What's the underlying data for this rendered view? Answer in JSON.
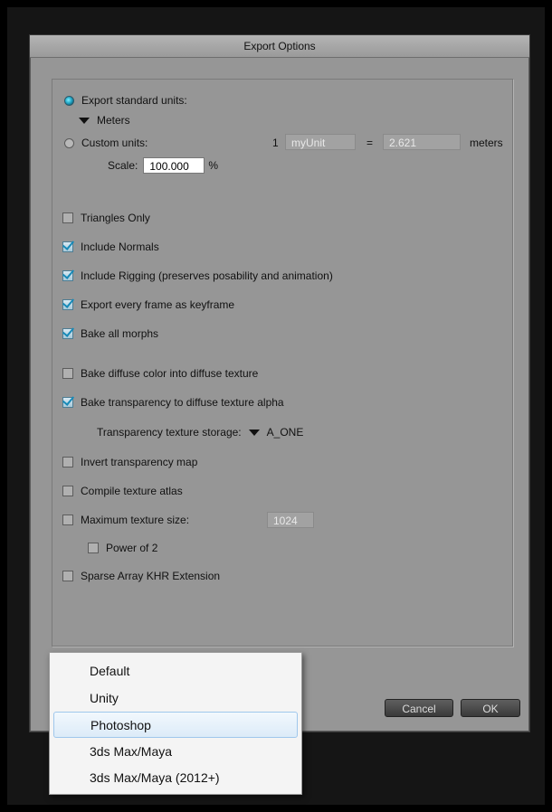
{
  "dialog": {
    "title": "Export Options",
    "units": {
      "standard_label": "Export standard units:",
      "standard_value": "Meters",
      "custom_label": "Custom units:",
      "custom_count": "1",
      "custom_name": "myUnit",
      "equals": "=",
      "custom_value": "2.621",
      "custom_suffix": "meters",
      "scale_label": "Scale:",
      "scale_value": "100.000",
      "scale_suffix": "%"
    },
    "options": {
      "triangles_only": {
        "label": "Triangles Only",
        "checked": false
      },
      "include_normals": {
        "label": "Include Normals",
        "checked": true
      },
      "include_rigging": {
        "label": "Include Rigging (preserves posability and animation)",
        "checked": true
      },
      "export_keyframes": {
        "label": "Export every frame as keyframe",
        "checked": true
      },
      "bake_morphs": {
        "label": "Bake all morphs",
        "checked": true
      },
      "bake_diffuse": {
        "label": "Bake diffuse color into diffuse texture",
        "checked": false
      },
      "bake_transparency": {
        "label": "Bake transparency to diffuse texture alpha",
        "checked": true
      },
      "transparency_storage_label": "Transparency texture storage:",
      "transparency_storage_value": "A_ONE",
      "invert_transparency": {
        "label": "Invert transparency map",
        "checked": false
      },
      "compile_atlas": {
        "label": "Compile texture atlas",
        "checked": false
      },
      "max_texture": {
        "label": "Maximum texture size:",
        "value": "1024",
        "checked": false
      },
      "power_of_2": {
        "label": "Power of 2",
        "checked": false
      },
      "sparse_array": {
        "label": "Sparse Array KHR Extension",
        "checked": false
      }
    },
    "buttons": {
      "cancel": "Cancel",
      "ok": "OK"
    }
  },
  "preset_menu": {
    "items": [
      "Default",
      "Unity",
      "Photoshop",
      "3ds Max/Maya",
      "3ds Max/Maya (2012+)"
    ],
    "selected": "Photoshop"
  }
}
